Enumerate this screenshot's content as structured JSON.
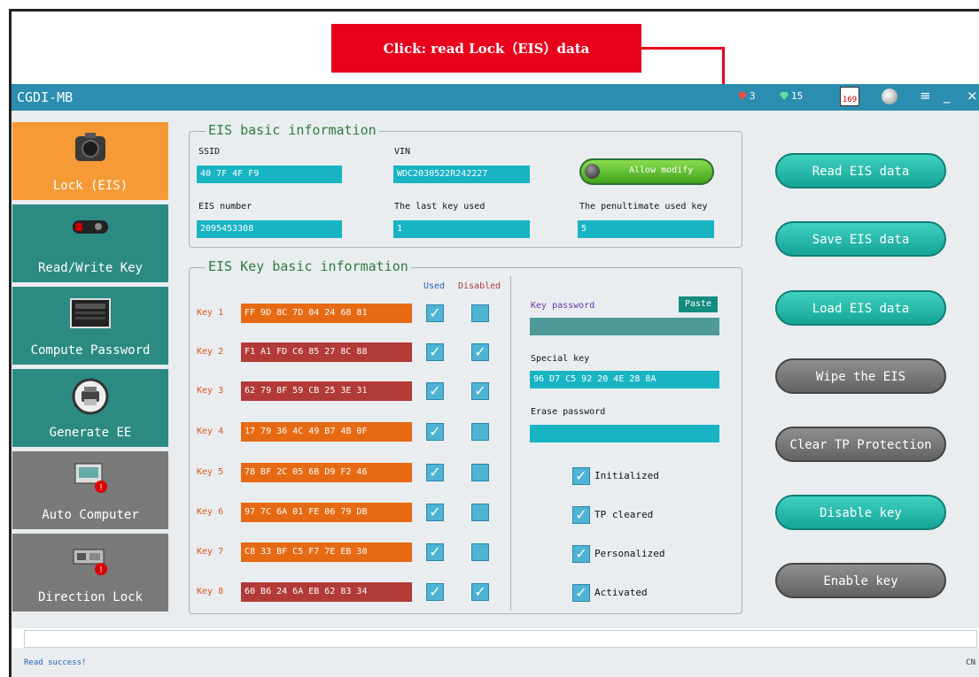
{
  "annotation": {
    "text": "Click: read Lock（EIS）data"
  },
  "window": {
    "title": "CGDI-MB",
    "toolbar": {
      "red_gems": "3",
      "green_gems": "15",
      "calendar": "169"
    }
  },
  "sidebar": {
    "items": [
      {
        "label": "Lock (EIS)",
        "icon": "lock-eis-icon"
      },
      {
        "label": "Read/Write Key",
        "icon": "car-key-icon"
      },
      {
        "label": "Compute Password",
        "icon": "password-device-icon"
      },
      {
        "label": "Generate EE",
        "icon": "printer-icon"
      },
      {
        "label": "Auto Computer",
        "icon": "auto-computer-icon"
      },
      {
        "label": "Direction Lock",
        "icon": "direction-lock-icon"
      }
    ]
  },
  "eis_basic": {
    "title": "EIS basic information",
    "ssid_label": "SSID",
    "ssid": "40 7F 4F F9",
    "vin_label": "VIN",
    "vin": "WDC2030522R242227",
    "allow_modify": "Allow modify",
    "eis_number_label": "EIS number",
    "eis_number": "2095453308",
    "last_key_label": "The last key used",
    "last_key": "1",
    "penultimate_label": "The penultimate used key",
    "penultimate": "5"
  },
  "eis_key": {
    "title": "EIS Key basic information",
    "used_label": "Used",
    "disabled_label": "Disabled",
    "keys": [
      {
        "label": "Key 1",
        "value": "FF 9D 8C 7D 04 24 68 81",
        "used": true,
        "disabled": false,
        "style": "orange"
      },
      {
        "label": "Key 2",
        "value": "F1 A1 FD C6 85 27 8C 88",
        "used": true,
        "disabled": true,
        "style": "red"
      },
      {
        "label": "Key 3",
        "value": "62 79 8F 59 CB 25 3E 31",
        "used": true,
        "disabled": true,
        "style": "red"
      },
      {
        "label": "Key 4",
        "value": "17 79 36 4C 49 B7 4B 0F",
        "used": true,
        "disabled": false,
        "style": "orange"
      },
      {
        "label": "Key 5",
        "value": "78 BF 2C 05 6B D9 F2 46",
        "used": true,
        "disabled": false,
        "style": "orange"
      },
      {
        "label": "Key 6",
        "value": "97 7C 6A 01 FE 06 79 DB",
        "used": true,
        "disabled": false,
        "style": "orange"
      },
      {
        "label": "Key 7",
        "value": "C8 33 BF C5 F7 7E EB 30",
        "used": true,
        "disabled": false,
        "style": "orange"
      },
      {
        "label": "Key 8",
        "value": "60 B6 24 6A EB 62 83 34",
        "used": true,
        "disabled": true,
        "style": "red"
      }
    ],
    "key_password_label": "Key password",
    "paste": "Paste",
    "key_password": "",
    "special_key_label": "Special key",
    "special_key": "96 D7 C5 92 20 4E 28 8A",
    "erase_password_label": "Erase password",
    "erase_password": "",
    "flags": [
      {
        "label": "Initialized",
        "checked": true
      },
      {
        "label": "TP cleared",
        "checked": true
      },
      {
        "label": "Personalized",
        "checked": true
      },
      {
        "label": "Activated",
        "checked": true
      }
    ]
  },
  "actions": {
    "read": "Read  EIS data",
    "save": "Save EIS data",
    "load": "Load EIS data",
    "wipe": "Wipe the EIS",
    "clear_tp": "Clear TP Protection",
    "disable": "Disable key",
    "enable": "Enable key"
  },
  "status": {
    "message": "Read success!",
    "lang": "CN"
  },
  "colors": {
    "accent_orange": "#f59a35",
    "teal": "#2b8b83",
    "title_blue": "#2b8eb0",
    "field_cyan": "#18b4c4",
    "callout_red": "#e8001c"
  }
}
